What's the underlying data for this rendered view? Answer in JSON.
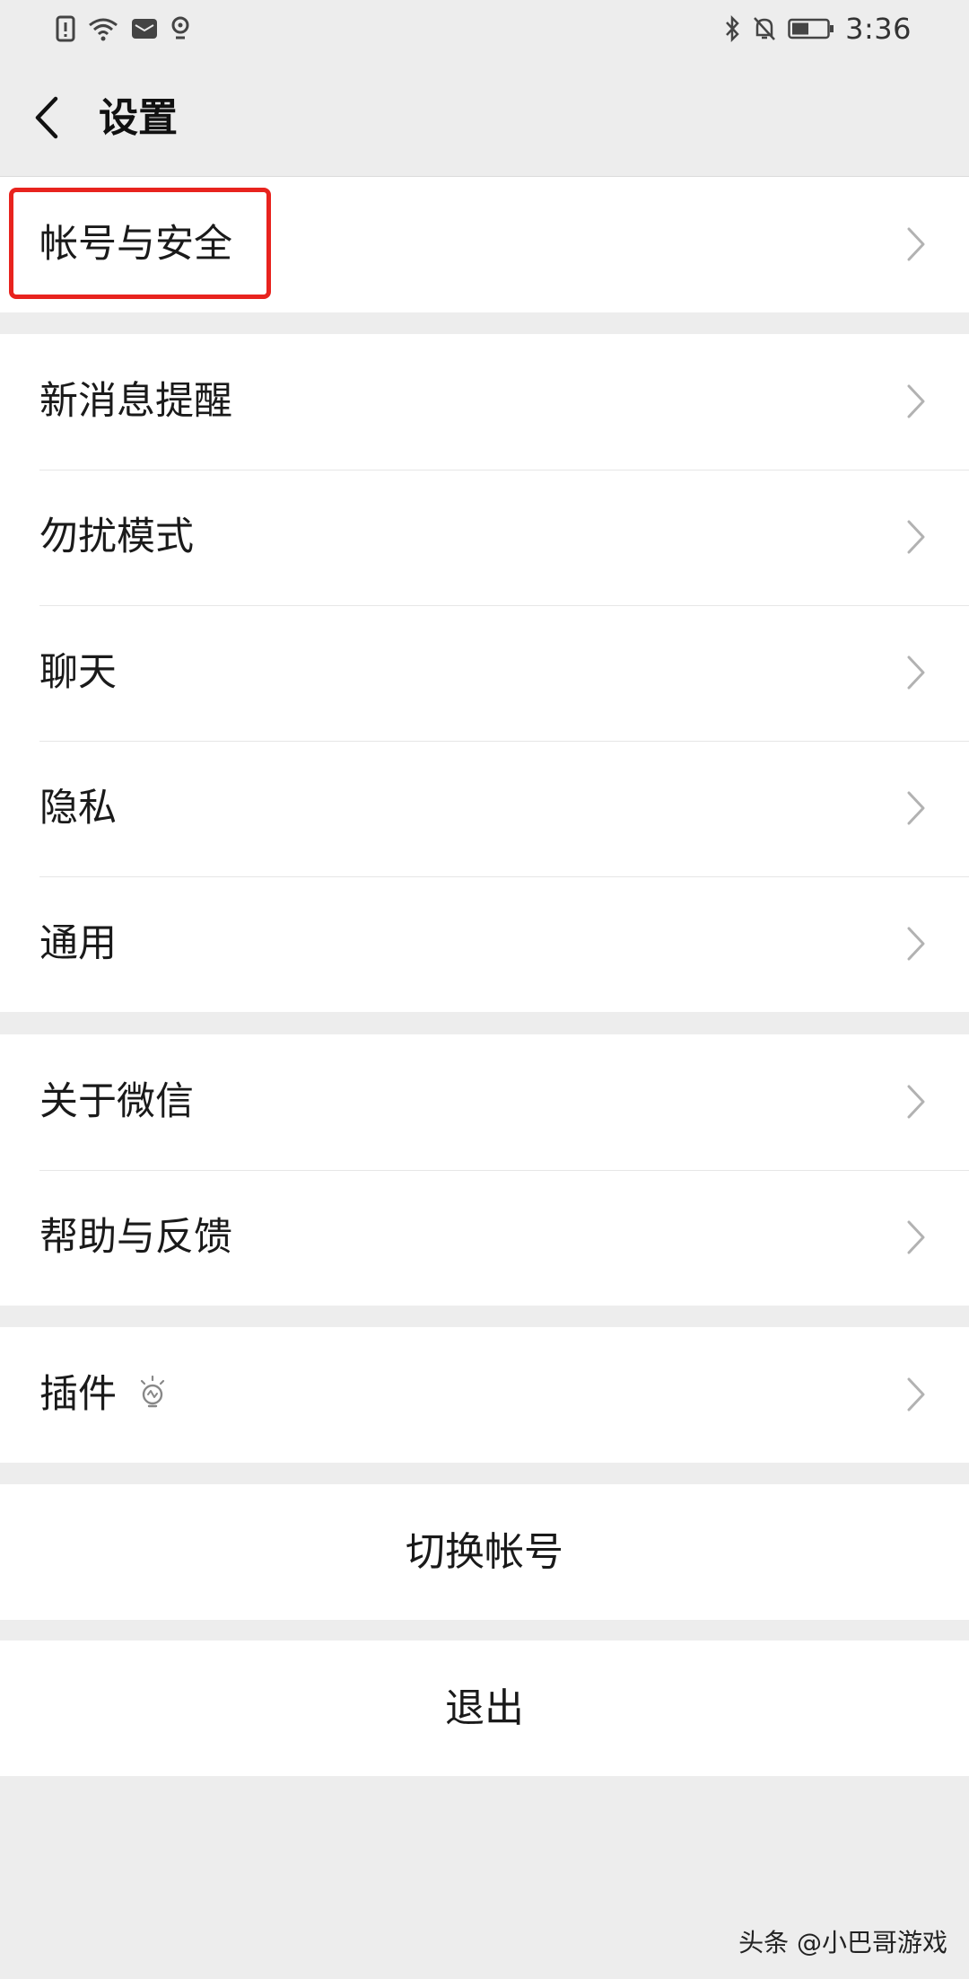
{
  "status_bar": {
    "time": "3:36",
    "left_icons": [
      "sim-alert-icon",
      "wifi-icon",
      "mail-icon",
      "location-icon"
    ],
    "right_icons": [
      "bluetooth-icon",
      "mute-bell-icon",
      "battery-icon"
    ]
  },
  "header": {
    "back_icon": "chevron-left-icon",
    "title": "设置"
  },
  "groups": {
    "account": {
      "items": [
        {
          "label": "帐号与安全",
          "highlighted": true
        }
      ]
    },
    "main": {
      "items": [
        {
          "label": "新消息提醒"
        },
        {
          "label": "勿扰模式"
        },
        {
          "label": "聊天"
        },
        {
          "label": "隐私"
        },
        {
          "label": "通用"
        }
      ]
    },
    "about": {
      "items": [
        {
          "label": "关于微信"
        },
        {
          "label": "帮助与反馈"
        }
      ]
    },
    "plugins": {
      "items": [
        {
          "label": "插件",
          "icon": "lightbulb-icon"
        }
      ]
    }
  },
  "actions": {
    "switch_account": "切换帐号",
    "logout": "退出"
  },
  "watermark": "头条 @小巴哥游戏",
  "colors": {
    "background": "#ededed",
    "row_background": "#ffffff",
    "highlight": "#e8231e",
    "text": "#1a1a1a",
    "chevron": "#b2b2b2"
  }
}
